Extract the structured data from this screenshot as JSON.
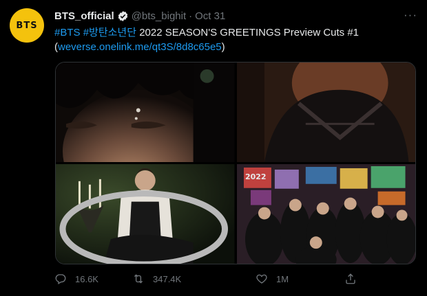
{
  "tweet": {
    "avatar_text": "BTS",
    "display_name": "BTS_official",
    "handle": "@bts_bighit",
    "separator": "·",
    "date": "Oct 31",
    "more": "···",
    "text": {
      "tag1": "#BTS",
      "tag2": "#방탄소년단",
      "body": " 2022 SEASON'S GREETINGS Preview Cuts #1",
      "open": "(",
      "link": "weverse.onelink.me/qt3S/8d8c65e5",
      "close": ")"
    },
    "badge_label": "2022",
    "actions": {
      "reply_count": "16.6K",
      "retweet_count": "347.4K",
      "like_count": "1M"
    }
  },
  "colors": {
    "background": "#000000",
    "text": "#e7e9ea",
    "muted": "#71767b",
    "link": "#1d9bf0",
    "avatar": "#f4c20d"
  }
}
